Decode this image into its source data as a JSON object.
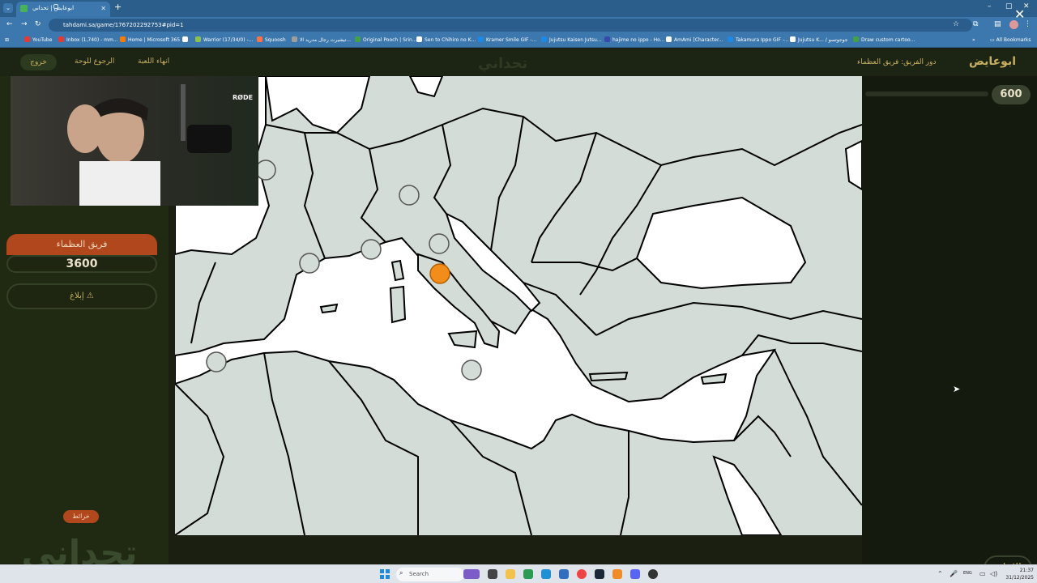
{
  "browser": {
    "tab_title": "ابوعايض | تحداني",
    "tab_menu_icon": "chevron-down-icon",
    "url": "tahdami.sa/game/1767202292753#pid=1",
    "bookmarks": [
      {
        "label": "YouTube",
        "color": "#e53935"
      },
      {
        "label": "Inbox (1,740) - mm...",
        "color": "#e53935"
      },
      {
        "label": "Home | Microsoft 365",
        "color": "#f57c00"
      },
      {
        "label": "",
        "color": "#ffffff"
      },
      {
        "label": "Warrior (17/34/0) -...",
        "color": "#8bc34a"
      },
      {
        "label": "Squoosh",
        "color": "#ff7043"
      },
      {
        "label": "تيشيرت رجال مدريد الا...",
        "color": "#9e9e9e"
      },
      {
        "label": "Original Pooch | Srin...",
        "color": "#43a047"
      },
      {
        "label": "Sen to Chihiro no K...",
        "color": "#ffffff"
      },
      {
        "label": "Kramer Smile GIF -...",
        "color": "#1e88e5"
      },
      {
        "label": "Jujutsu Kaisen Jutsu...",
        "color": "#1e88e5"
      },
      {
        "label": "hajime no ippo - Ho...",
        "color": "#3949ab"
      },
      {
        "label": "AmAmi [Character...",
        "color": "#ffffff"
      },
      {
        "label": "Takamura Ippo GIF -...",
        "color": "#1e88e5"
      },
      {
        "label": "Jujutsu K... / جوجوتسو",
        "color": "#ffffff"
      },
      {
        "label": "Draw custom cartoo...",
        "color": "#43a047"
      }
    ],
    "all_bookmarks": "All Bookmarks"
  },
  "game": {
    "exit_label": "خروج",
    "back_label": "الرجوع للوحة",
    "end_label": "انهاء اللعبة",
    "logo_text": "تحداني",
    "turn_label": "دور الفريق: فريق العظماء",
    "player_name": "ابوعايض",
    "points": "600",
    "team_name": "فريق العظماء",
    "team_score": "3600",
    "report_label": "إبلاغ ⚠",
    "category": "خرائط",
    "answer_label": "الإجابة",
    "webcam_mic_label": "RØDE",
    "accent_color": "#b0471d",
    "marker_selected_color": "#f28c1a"
  },
  "taskbar": {
    "search_placeholder": "Search",
    "lang": "ENG",
    "time": "21:37",
    "date": "31/12/2025"
  }
}
